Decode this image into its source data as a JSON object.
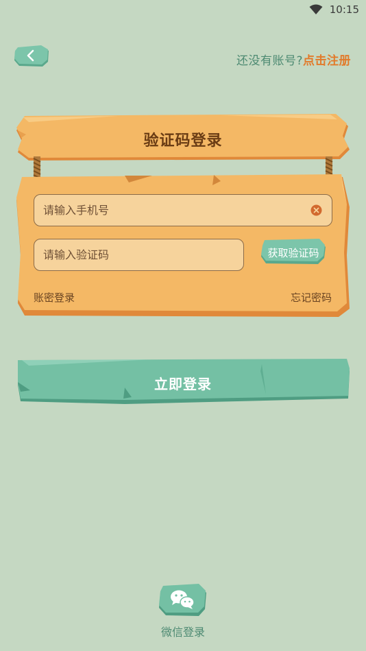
{
  "status_bar": {
    "time": "10:15",
    "wifi_icon": "wifi-icon"
  },
  "header": {
    "back_icon": "chevron-left-icon",
    "register_question": "还没有账号?",
    "register_link": "点击注册"
  },
  "title_board": {
    "title": "验证码登录"
  },
  "form": {
    "phone": {
      "value": "",
      "placeholder": "请输入手机号",
      "clear_icon": "clear-icon"
    },
    "code": {
      "value": "",
      "placeholder": "请输入验证码"
    },
    "get_code_label": "获取验证码",
    "password_login_label": "账密登录",
    "forgot_password_label": "忘记密码"
  },
  "login_button": {
    "label": "立即登录"
  },
  "wechat": {
    "icon": "wechat-icon",
    "label": "微信登录"
  },
  "colors": {
    "background": "#c5d8c2",
    "wood": "#f4b865",
    "wood_edge": "#e0893a",
    "stone": "#6bbca0",
    "accent_orange": "#e27a2a",
    "green_text": "#4d8a72"
  }
}
